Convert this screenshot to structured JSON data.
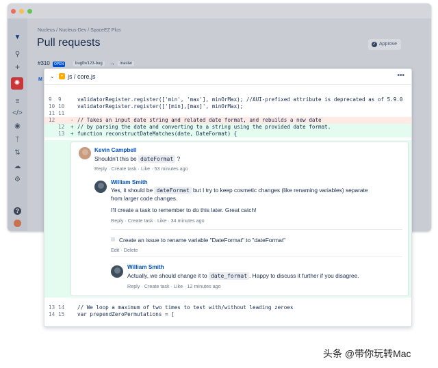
{
  "window": {
    "breadcrumb": [
      "Nucleus",
      "Nucleus-Dev",
      "SpaceEZ Plus"
    ],
    "breadcrumb_sep": "/",
    "title": "Pull requests",
    "approve_label": "Approve",
    "pr_number": "#310",
    "pr_status": "OPEN",
    "source_branch": "bugfix/123-bug",
    "arrow": "→",
    "target_branch": "master",
    "tab_peek": "M",
    "sidebar_icons": [
      "bitbucket-logo-icon",
      "search-icon",
      "plus-icon",
      "project-icon",
      "list-icon",
      "code-icon",
      "commit-icon",
      "branches-icon",
      "pull-request-icon",
      "deployments-icon",
      "settings-icon",
      "help-icon",
      "user-avatar-icon"
    ]
  },
  "file": {
    "collapse_glyph": "⌄",
    "path": "js / core.js",
    "more_glyph": "•••",
    "lines": [
      {
        "old": "9",
        "new": "9",
        "mark": "",
        "type": "ctx",
        "text": "validatorRegister.register(['min', 'max'], minOrMax); //AUI-prefixed attribute is deprecated as of 5.9.0"
      },
      {
        "old": "10",
        "new": "10",
        "mark": "",
        "type": "ctx",
        "text": "validatorRegister.register(['[min],[max]', minOrMax);"
      },
      {
        "old": "11",
        "new": "11",
        "mark": "",
        "type": "ctx",
        "text": ""
      },
      {
        "old": "12",
        "new": "",
        "mark": "-",
        "type": "del",
        "text": "// Takes an input date string and related date format, and rebuilds a new date"
      },
      {
        "old": "",
        "new": "12",
        "mark": "+",
        "type": "add",
        "text": "// by parsing the date and converting to a string using the provided date format."
      },
      {
        "old": "",
        "new": "13",
        "mark": "+",
        "type": "add",
        "text": "function reconstructDateMatches(date, DateFormat) {"
      },
      {
        "old": "13",
        "new": "14",
        "mark": "",
        "type": "ctx",
        "text": "// We loop a maximum of two times to test with/without leading zeroes"
      },
      {
        "old": "14",
        "new": "15",
        "mark": "",
        "type": "ctx",
        "text": "var prependZeroPermutations = ["
      }
    ]
  },
  "comments": {
    "first": {
      "author": "Kevin Campbell",
      "text_before": "Shouldn't this be",
      "code": "dateFormat",
      "text_after": "?",
      "actions": [
        "Reply",
        "Create task",
        "Like",
        "53 minutes ago"
      ]
    },
    "second": {
      "author": "William Smith",
      "line1_before": "Yes, it should be",
      "line1_code": "dateFormat",
      "line1_after": "but I try to keep cosmetic changes (like renaming variables) separate",
      "line2": "from larger code changes.",
      "line3": "I'll create a task to remember to do this later. Great catch!",
      "actions": [
        "Reply",
        "Create task",
        "Like",
        "34 minutes ago"
      ]
    },
    "task": {
      "text": "Create an issue to rename variable \"DateFormat\" to \"dateFormat\"",
      "actions": [
        "Edit",
        "Delete"
      ]
    },
    "third": {
      "author": "William Smith",
      "text_before": "Actually, we should change it to",
      "code": "date_format",
      "text_after": ". Happy to discuss it further if you disagree.",
      "actions": [
        "Reply",
        "Create task",
        "Like",
        "12 minutes ago"
      ]
    }
  },
  "watermark": "头条 @带你玩转Mac",
  "colors": {
    "link_blue": "#0052cc",
    "deleted_bg": "#ffebe6",
    "added_bg": "#e3fcef",
    "active_nav": "#c9363a",
    "open_badge": "#0052cc"
  }
}
